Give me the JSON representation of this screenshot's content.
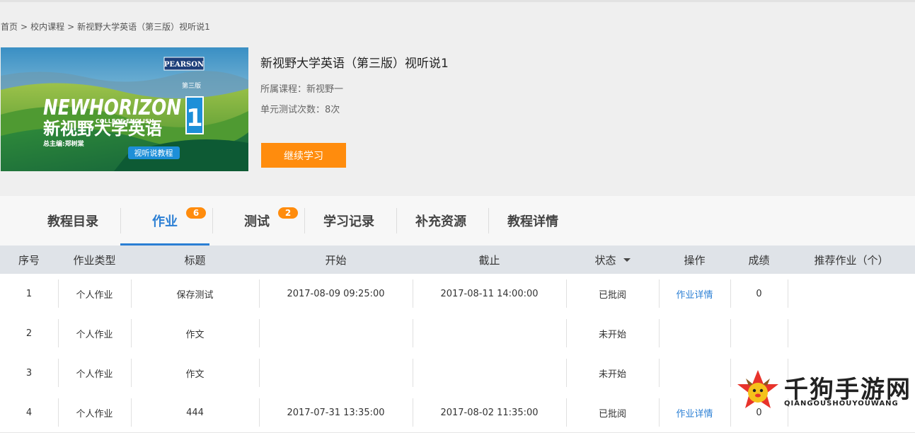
{
  "breadcrumb": {
    "items": [
      "首页",
      "校内课程",
      "新视野大学英语（第三版）视听说1"
    ],
    "separator": ">"
  },
  "cover": {
    "publisher": "PEARSON",
    "brand_line": "NEWHORIZON",
    "brand_sub": "COLLEGE ENGLISH",
    "edition": "第三版",
    "title": "新视野大学英语",
    "volume": "1",
    "editor": "总主编:郑树棠",
    "tag": "视听说教程"
  },
  "course": {
    "title": "新视野大学英语（第三版）视听说1",
    "belongs_label": "所属课程：新视野一",
    "tests_label": "单元测试次数：8次",
    "continue_label": "继续学习"
  },
  "tabs": [
    {
      "label": "教程目录",
      "badge": null
    },
    {
      "label": "作业",
      "badge": "6"
    },
    {
      "label": "测试",
      "badge": "2"
    },
    {
      "label": "学习记录",
      "badge": null
    },
    {
      "label": "补充资源",
      "badge": null
    },
    {
      "label": "教程详情",
      "badge": null
    }
  ],
  "table": {
    "headers": [
      "序号",
      "作业类型",
      "标题",
      "开始",
      "截止",
      "状态",
      "操作",
      "成绩",
      "推荐作业（个）"
    ],
    "rows": [
      {
        "no": "1",
        "type": "个人作业",
        "title": "保存测试",
        "start": "2017-08-09 09:25:00",
        "end": "2017-08-11 14:00:00",
        "status": "已批阅",
        "action": "作业详情",
        "score": "0",
        "rec": ""
      },
      {
        "no": "2",
        "type": "个人作业",
        "title": "作文",
        "start": "",
        "end": "",
        "status": "未开始",
        "action": "",
        "score": "",
        "rec": ""
      },
      {
        "no": "3",
        "type": "个人作业",
        "title": "作文",
        "start": "",
        "end": "",
        "status": "未开始",
        "action": "",
        "score": "",
        "rec": ""
      },
      {
        "no": "4",
        "type": "个人作业",
        "title": "444",
        "start": "2017-07-31 13:35:00",
        "end": "2017-08-02 11:35:00",
        "status": "已批阅",
        "action": "作业详情",
        "score": "0",
        "rec": ""
      }
    ]
  },
  "watermark": {
    "title": "千狗手游网",
    "subtitle": "QIANGOUSHOUYOUWANG"
  },
  "colors": {
    "accent": "#2b7fd4",
    "orange": "#ff8c0d",
    "header_bg": "#dfe3e8"
  }
}
